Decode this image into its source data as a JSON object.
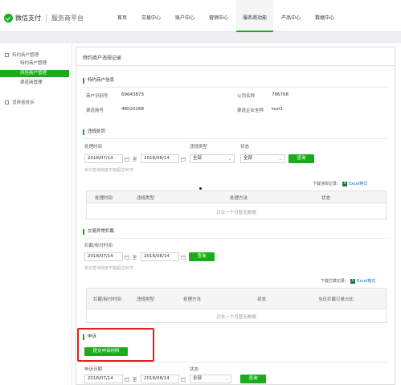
{
  "header": {
    "brand": "微信支付",
    "platform": "服务商平台",
    "nav": [
      "首页",
      "交易中心",
      "账户中心",
      "营销中心",
      "服务商功能",
      "产品中心",
      "数据中心"
    ],
    "active_nav": "服务商功能"
  },
  "sidebar": {
    "group1": "特约商户管理",
    "items": [
      "特约商户管理",
      "风险商户管理",
      "渠道商管理"
    ],
    "active_item": "风险商户管理",
    "group2": "消费者投诉"
  },
  "page": {
    "title": "特约商户违规记录"
  },
  "merchant_info": {
    "section_title": "特约商户信息",
    "merchant_id_label": "商户识别号",
    "merchant_id": "69643873",
    "company_label": "公司名称",
    "company": "786768",
    "channel_id_label": "渠道商号",
    "channel_id": "48020268",
    "channel_name_label": "渠道企业全称",
    "channel_name": "test1"
  },
  "violation": {
    "section_title": "违规处罚",
    "time_label": "处理时间",
    "date_from": "2018/07/14",
    "date_sep": "至",
    "date_to": "2018/08/14",
    "type_label": "违规类型",
    "type_value": "全部",
    "status_label": "状态",
    "status_value": "全部",
    "query_button": "查询",
    "hint": "单次查询跨度不能超过90天",
    "download_label": "下载违规记录：",
    "excel_icon": "X",
    "excel_link": "Excel格式",
    "columns": [
      "处理时间",
      "违规类型",
      "处理方法",
      "状态"
    ],
    "empty_text": "过去一个月暂无数据"
  },
  "intercept": {
    "section_title": "交易异常拦截",
    "time_label": "拦截/标付时间",
    "date_from": "2018/07/14",
    "date_sep": "至",
    "date_to": "2018/08/14",
    "query_button": "查询",
    "hint": "单次查询跨度不能超过90天",
    "download_label": "下载拦截记录：",
    "excel_icon": "X",
    "excel_link": "Excel格式",
    "columns": [
      "拦截/标付时间",
      "违规类型",
      "处理方法",
      "状态",
      "当日拦截订单占比"
    ],
    "empty_text": "过去一个月暂无数据"
  },
  "appeal": {
    "section_title": "申诉",
    "submit_button": "提交申诉材料",
    "date_label": "申诉日期",
    "date_from": "2018/07/14",
    "date_sep": "至",
    "date_to": "2018/08/14",
    "status_label": "状态",
    "status_value": "全部",
    "query_button": "查询"
  },
  "colors": {
    "brand_green": "#1aad19",
    "highlight_red": "#e02020",
    "link_blue": "#2b6fc0"
  }
}
